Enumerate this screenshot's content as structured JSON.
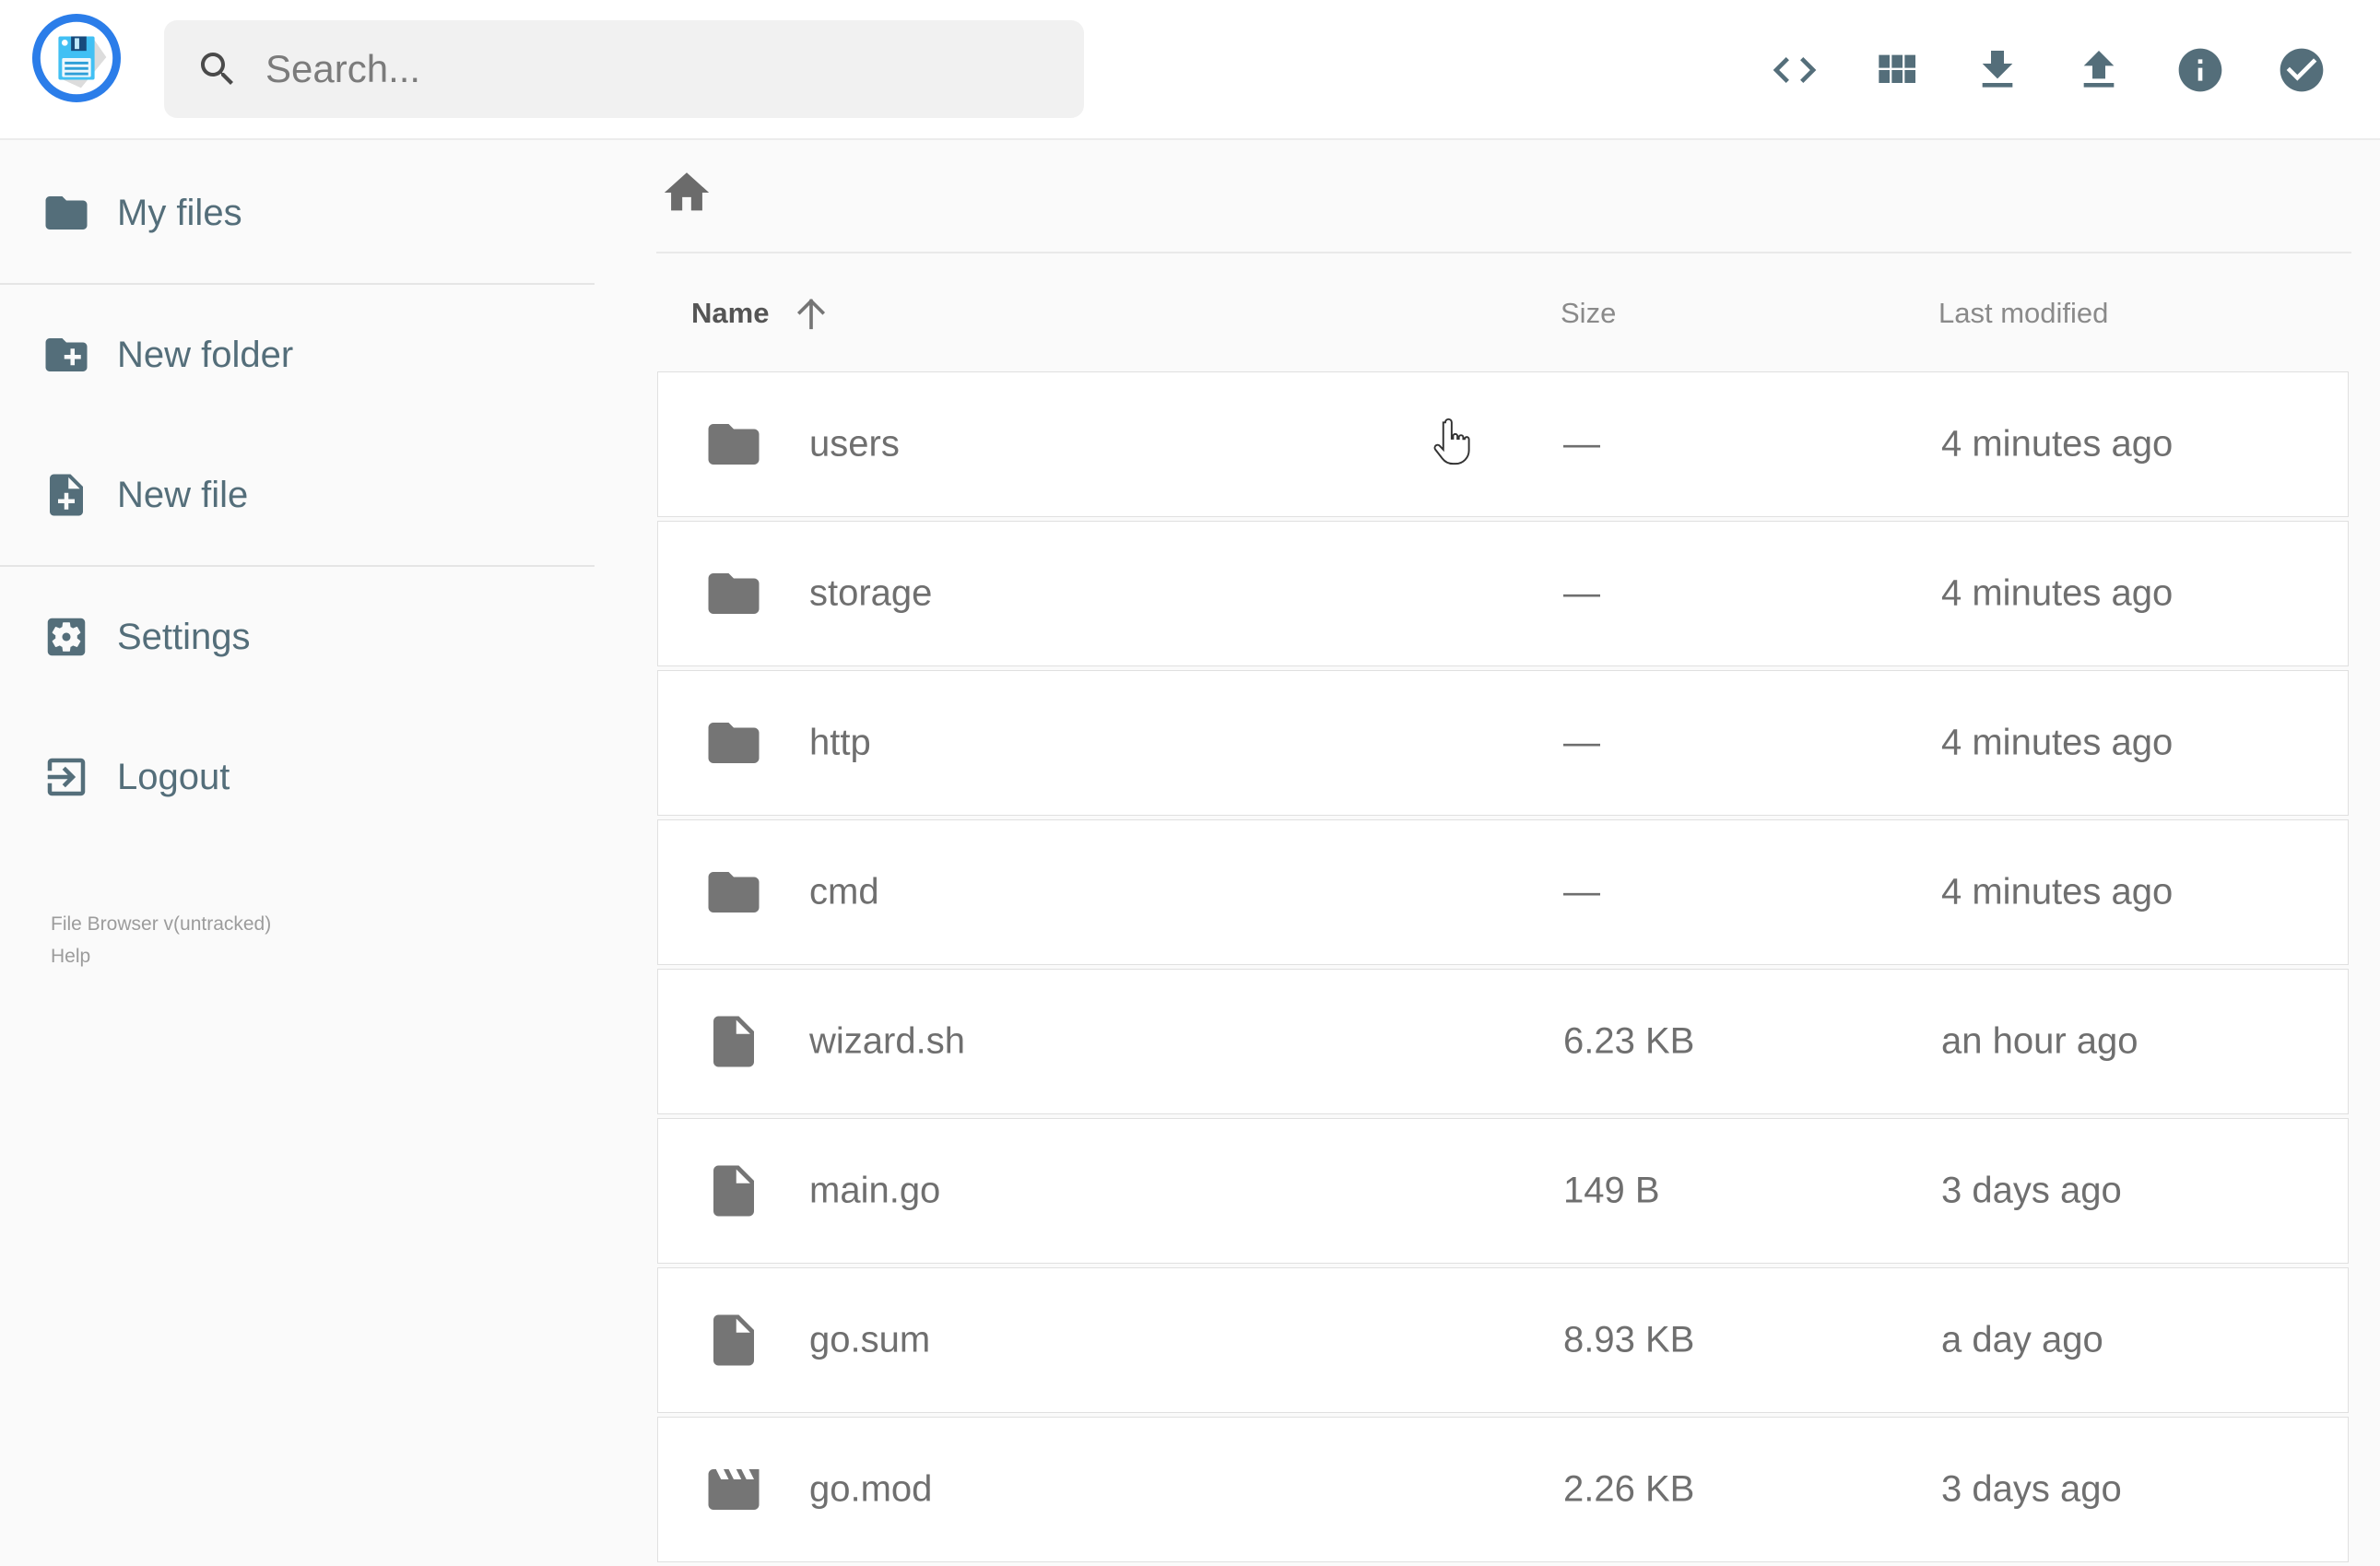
{
  "header": {
    "search_placeholder": "Search...",
    "actions": [
      {
        "icon": "code-brackets-icon"
      },
      {
        "icon": "grid-view-icon"
      },
      {
        "icon": "download-icon"
      },
      {
        "icon": "upload-icon"
      },
      {
        "icon": "info-icon"
      },
      {
        "icon": "check-circle-icon"
      }
    ]
  },
  "sidebar": {
    "items": [
      {
        "label": "My files",
        "icon": "folder"
      },
      {
        "label": "New folder",
        "icon": "create-new-folder"
      },
      {
        "label": "New file",
        "icon": "note-add"
      },
      {
        "label": "Settings",
        "icon": "settings"
      },
      {
        "label": "Logout",
        "icon": "logout"
      }
    ],
    "footer": {
      "version": "File Browser v(untracked)",
      "help": "Help"
    }
  },
  "listing": {
    "columns": {
      "name": "Name",
      "size": "Size",
      "modified": "Last modified"
    },
    "sort": {
      "column": "name",
      "direction": "ascending"
    },
    "rows": [
      {
        "name": "users",
        "icon": "folder",
        "size": "—",
        "modified": "4 minutes ago"
      },
      {
        "name": "storage",
        "icon": "folder",
        "size": "—",
        "modified": "4 minutes ago"
      },
      {
        "name": "http",
        "icon": "folder",
        "size": "—",
        "modified": "4 minutes ago"
      },
      {
        "name": "cmd",
        "icon": "folder",
        "size": "—",
        "modified": "4 minutes ago"
      },
      {
        "name": "wizard.sh",
        "icon": "file",
        "size": "6.23 KB",
        "modified": "an hour ago"
      },
      {
        "name": "main.go",
        "icon": "file",
        "size": "149 B",
        "modified": "3 days ago"
      },
      {
        "name": "go.sum",
        "icon": "file",
        "size": "8.93 KB",
        "modified": "a day ago"
      },
      {
        "name": "go.mod",
        "icon": "movie",
        "size": "2.26 KB",
        "modified": "3 days ago"
      }
    ]
  },
  "colors": {
    "brand_blue": "#2b7de9",
    "logo_light_blue": "#41c0f4",
    "slate": "#546e7a",
    "row_text": "#6f6f6f",
    "background": "#fafafa"
  }
}
